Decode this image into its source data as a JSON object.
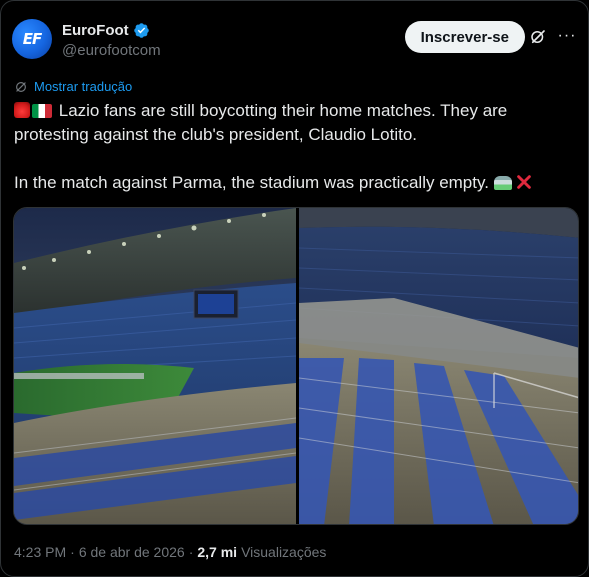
{
  "account": {
    "display_name": "EuroFoot",
    "handle": "@eurofootcom",
    "avatar_text": "EF"
  },
  "actions": {
    "subscribe_label": "Inscrever-se"
  },
  "translate": {
    "label": "Mostrar tradução"
  },
  "tweet": {
    "line1": "Lazio fans are still boycotting their home matches. They are",
    "line2": "protesting against the club's president, Claudio Lotito.",
    "line3": "In the match against Parma, the stadium was practically empty."
  },
  "footer": {
    "time": "4:23 PM",
    "separator": "·",
    "date": "6 de abr de 2026",
    "separator2": "·",
    "views_count": "2,7 mi",
    "views_label": "Visualizações"
  },
  "icons": {
    "verified": "verified-badge-icon",
    "grok": "grok-icon",
    "more": "more-icon",
    "translate": "translate-icon"
  },
  "colors": {
    "background": "#000000",
    "text": "#e7e9ea",
    "secondary": "#71767b",
    "link": "#1d9bf0",
    "button_bg": "#eff3f4"
  }
}
